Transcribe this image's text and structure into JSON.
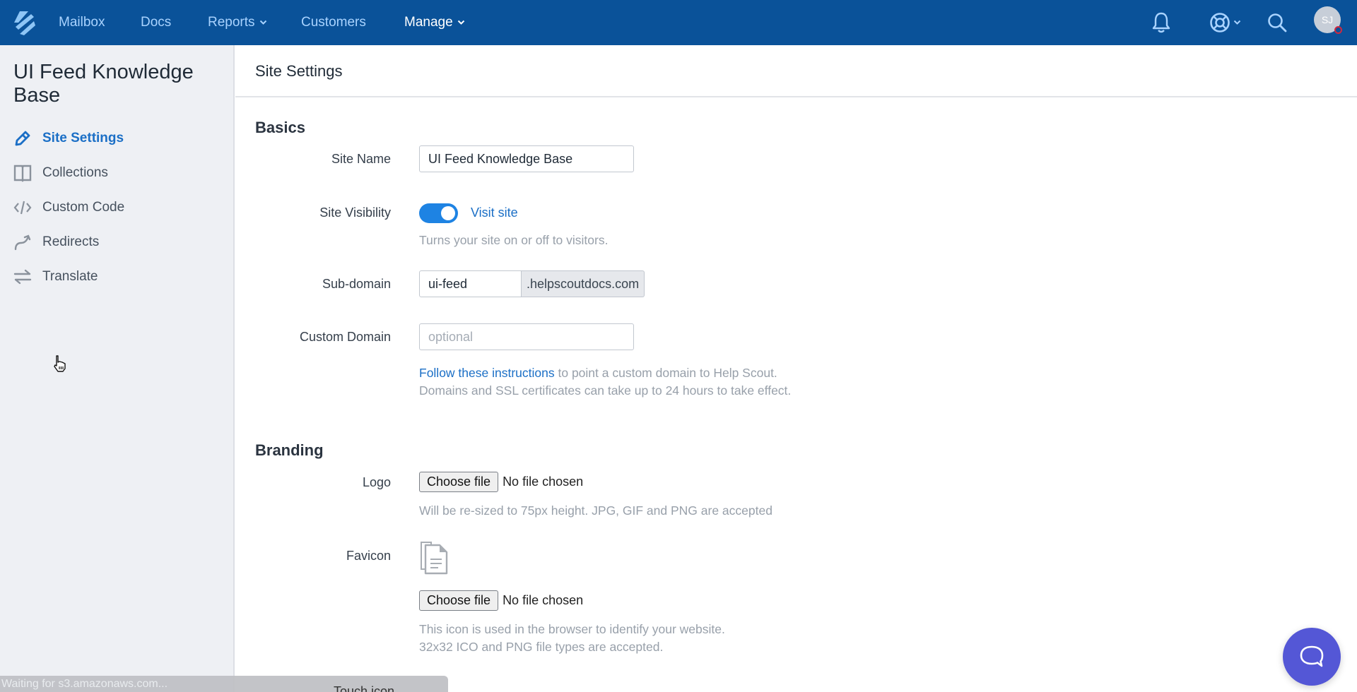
{
  "topnav": {
    "items": [
      {
        "label": "Mailbox",
        "dropdown": false,
        "active": false
      },
      {
        "label": "Docs",
        "dropdown": false,
        "active": false
      },
      {
        "label": "Reports",
        "dropdown": true,
        "active": false
      },
      {
        "label": "Customers",
        "dropdown": false,
        "active": false
      },
      {
        "label": "Manage",
        "dropdown": true,
        "active": true
      }
    ],
    "icons": [
      "notifications-bell-icon",
      "help-lifebuoy-icon",
      "search-icon"
    ],
    "avatar_initials": "SJ",
    "brand_color": "#0a5299",
    "notification_dot_color": "#d0283f"
  },
  "sidebar": {
    "title": "UI Feed Knowledge Base",
    "items": [
      {
        "label": "Site Settings",
        "icon": "pencil-icon",
        "active": true
      },
      {
        "label": "Collections",
        "icon": "book-icon",
        "active": false
      },
      {
        "label": "Custom Code",
        "icon": "code-icon",
        "active": false
      },
      {
        "label": "Redirects",
        "icon": "redirect-arrow-icon",
        "active": false
      },
      {
        "label": "Translate",
        "icon": "swap-arrows-icon",
        "active": false
      }
    ]
  },
  "main": {
    "page_title": "Site Settings",
    "basics": {
      "heading": "Basics",
      "site_name": {
        "label": "Site Name",
        "value": "UI Feed Knowledge Base"
      },
      "site_visibility": {
        "label": "Site Visibility",
        "enabled": true,
        "link": "Visit site",
        "help": "Turns your site on or off to visitors."
      },
      "subdomain": {
        "label": "Sub-domain",
        "value": "ui-feed",
        "suffix": ".helpscoutdocs.com"
      },
      "custom_domain": {
        "label": "Custom Domain",
        "value": "",
        "placeholder": "optional",
        "help_link": "Follow these instructions",
        "help_rest": " to point a custom domain to Help Scout.",
        "help_line2": "Domains and SSL certificates can take up to 24 hours to take effect."
      }
    },
    "branding": {
      "heading": "Branding",
      "logo": {
        "label": "Logo",
        "button": "Choose file",
        "status": "No file chosen",
        "help": "Will be re-sized to 75px height. JPG, GIF and PNG are accepted"
      },
      "favicon": {
        "label": "Favicon",
        "button": "Choose file",
        "status": "No file chosen",
        "help_line1": "This icon is used in the browser to identify your website.",
        "help_line2": "32x32 ICO and PNG file types are accepted."
      },
      "touch_icon": {
        "label": "Touch icon"
      }
    }
  },
  "statusbar": {
    "text": "Waiting for s3.amazonaws.com..."
  },
  "beacon": {
    "icon": "chat-bubble-icon",
    "color": "#5457d6"
  }
}
